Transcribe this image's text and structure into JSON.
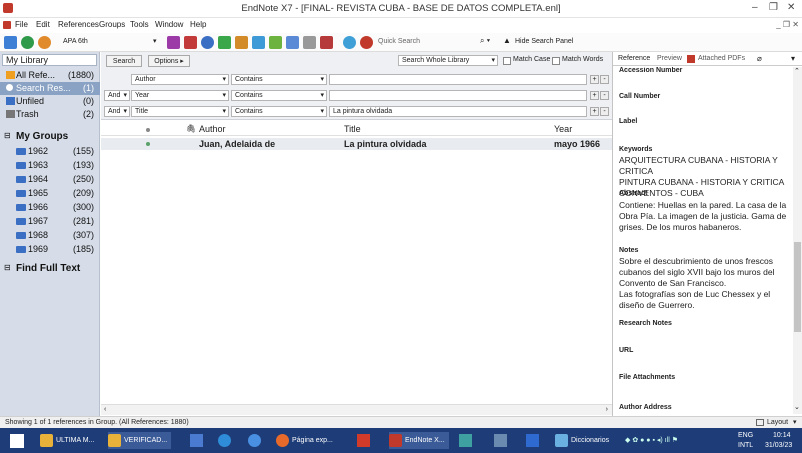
{
  "window": {
    "title": "EndNote X7 - [FINAL- REVISTA CUBA - BASE DE DATOS COMPLETA.enl]"
  },
  "menu": [
    "File",
    "Edit",
    "References",
    "Groups",
    "Tools",
    "Window",
    "Help"
  ],
  "toolbar": {
    "style": "APA 6th",
    "quick_search_placeholder": "Quick Search",
    "hide_search": "Hide Search Panel"
  },
  "library": {
    "title": "My Library",
    "items": [
      {
        "label": "All Refe...",
        "count": "(1880)"
      },
      {
        "label": "Search Res...",
        "count": "(1)"
      },
      {
        "label": "Unfiled",
        "count": "(0)"
      },
      {
        "label": "Trash",
        "count": "(2)"
      }
    ],
    "my_groups": "My Groups",
    "groups": [
      {
        "label": "1962",
        "count": "(155)"
      },
      {
        "label": "1963",
        "count": "(193)"
      },
      {
        "label": "1964",
        "count": "(250)"
      },
      {
        "label": "1965",
        "count": "(209)"
      },
      {
        "label": "1966",
        "count": "(300)"
      },
      {
        "label": "1967",
        "count": "(281)"
      },
      {
        "label": "1968",
        "count": "(307)"
      },
      {
        "label": "1969",
        "count": "(185)"
      }
    ],
    "find_full_text": "Find Full Text"
  },
  "search": {
    "search_btn": "Search",
    "options_btn": "Options ▸",
    "scope": "Search Whole Library",
    "match_case": "Match Case",
    "match_words": "Match Words",
    "rows": [
      {
        "bool": "",
        "field": "Author",
        "op": "Contains",
        "value": ""
      },
      {
        "bool": "And",
        "field": "Year",
        "op": "Contains",
        "value": ""
      },
      {
        "bool": "And",
        "field": "Title",
        "op": "Contains",
        "value": "La pintura olvidada"
      }
    ]
  },
  "table": {
    "headers": {
      "author": "Author",
      "title": "Title",
      "year": "Year"
    },
    "rows": [
      {
        "author": "Juan, Adelaida de",
        "title": "La pintura olvidada",
        "year": "mayo 1966"
      }
    ]
  },
  "right": {
    "tabs": [
      "Reference",
      "Preview",
      "Attached PDFs"
    ],
    "fields": [
      {
        "name": "Accession Number",
        "value": ""
      },
      {
        "name": "Call Number",
        "value": ""
      },
      {
        "name": "Label",
        "value": ""
      },
      {
        "name": "Keywords",
        "value": "ARQUITECTURA CUBANA - HISTORIA Y CRITICA\nPINTURA CUBANA - HISTORIA Y CRITICA\nCONVENTOS - CUBA"
      },
      {
        "name": "Abstract",
        "value": "Contiene: Huellas en la pared. La casa de la Obra Pía. La imagen de la justicia. Gama de grises. De los muros habaneros."
      },
      {
        "name": "Notes",
        "value": "Sobre el descubrimiento de unos frescos cubanos del siglo XVII bajo los muros del Convento de San Francisco.\nLas fotografías son de Luc Chessex y el diseño de Guerrero."
      },
      {
        "name": "Research Notes",
        "value": ""
      },
      {
        "name": "URL",
        "value": ""
      },
      {
        "name": "File Attachments",
        "value": ""
      },
      {
        "name": "Author Address",
        "value": ""
      }
    ]
  },
  "status": {
    "text": "Showing 1 of 1 references in Group. (All References: 1880)",
    "layout": "Layout"
  },
  "taskbar": {
    "items": [
      "ULTIMA M...",
      "VERIFICAD...",
      "Página exp...",
      "EndNote X...",
      "Diccionarios"
    ],
    "lang": "ENG",
    "lang2": "INTL",
    "time": "10:14",
    "date": "31/03/23"
  }
}
